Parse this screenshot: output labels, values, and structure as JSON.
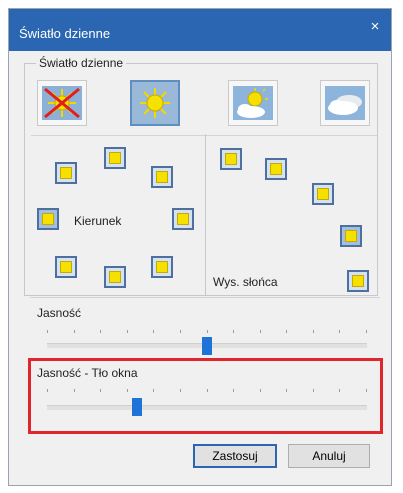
{
  "window": {
    "title": "Światło dzienne",
    "close_glyph": "×"
  },
  "group": {
    "label": "Światło dzienne"
  },
  "modes": [
    {
      "name": "no-daylight",
      "icon": "sun-crossed-out-icon",
      "selected": false
    },
    {
      "name": "sunny",
      "icon": "sun-icon",
      "selected": true
    },
    {
      "name": "partly-cloudy",
      "icon": "sun-behind-cloud-icon",
      "selected": false
    },
    {
      "name": "cloudy",
      "icon": "clouds-icon",
      "selected": false
    }
  ],
  "direction": {
    "label": "Kierunek"
  },
  "elevation": {
    "label": "Wys. słońca"
  },
  "brightness": {
    "label": "Jasność",
    "value": 0.5
  },
  "window_brightness": {
    "label": "Jasność - Tło okna",
    "value": 0.28
  },
  "buttons": {
    "apply": "Zastosuj",
    "cancel": "Anuluj"
  },
  "colors": {
    "titlebar": "#2a66b2",
    "highlight": "#e0262d",
    "slider_thumb": "#1e73d8"
  }
}
